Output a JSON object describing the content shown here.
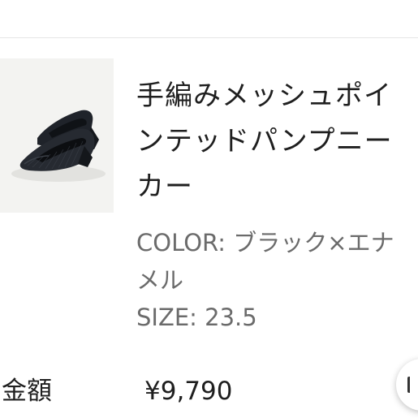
{
  "product": {
    "title_lines": [
      "手編みメッシュポイ",
      "ンテッドパンプニー",
      "カー"
    ],
    "color_lines": [
      "COLOR: ブラック×エナ",
      "メル"
    ],
    "size_text": "SIZE: 23.5",
    "image_icon": "shoe-photo"
  },
  "price": {
    "label": "金額",
    "value": "¥9,790"
  },
  "fab": {
    "icon": "chat-bubble-icon"
  }
}
